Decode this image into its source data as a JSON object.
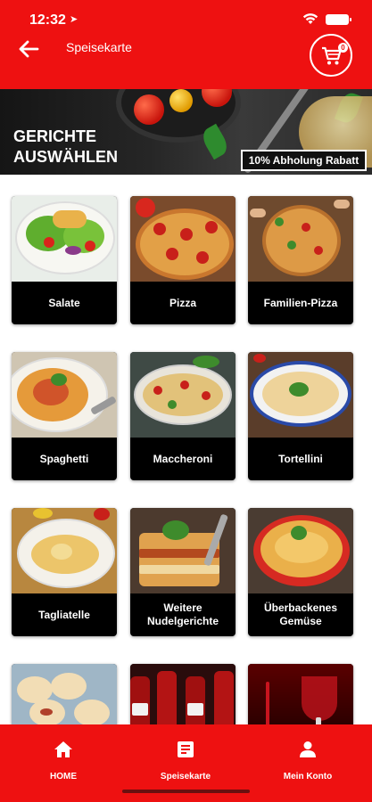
{
  "status_bar": {
    "time": "12:32",
    "location_arrow": "➤"
  },
  "header": {
    "title": "Speisekarte",
    "cart_count": "0"
  },
  "banner": {
    "heading_line1": "GERICHTE",
    "heading_line2": "AUSWÄHLEN",
    "badge": "10% Abholung Rabatt"
  },
  "categories": [
    {
      "label": "Salate"
    },
    {
      "label": "Pizza"
    },
    {
      "label": "Familien-Pizza"
    },
    {
      "label": "Spaghetti"
    },
    {
      "label": "Maccheroni"
    },
    {
      "label": "Tortellini"
    },
    {
      "label": "Tagliatelle"
    },
    {
      "label": "Weitere Nudelgerichte"
    },
    {
      "label": "Überbackenes Gemüse"
    }
  ],
  "bottom_nav": {
    "home": "HOME",
    "menu": "Speisekarte",
    "account": "Mein Konto"
  },
  "colors": {
    "brand_red": "#ee1111",
    "card_label_bg": "#000000"
  },
  "icons": [
    "back-arrow-icon",
    "cart-icon",
    "home-icon",
    "menu-icon",
    "account-icon",
    "wifi-icon",
    "battery-icon"
  ]
}
